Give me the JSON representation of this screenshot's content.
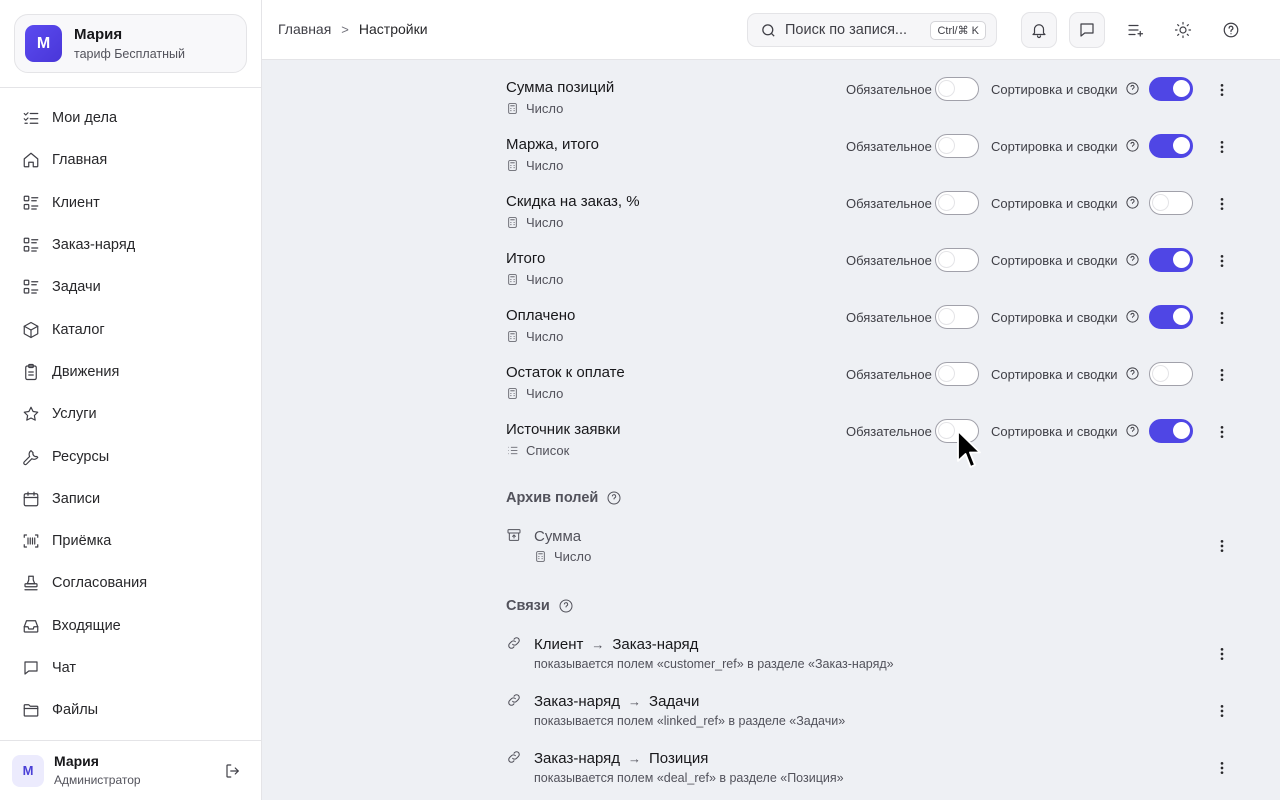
{
  "account": {
    "initial": "М",
    "name": "Мария",
    "plan": "тариф Бесплатный"
  },
  "nav": [
    {
      "label": "Мои дела",
      "icon": "checklist-icon"
    },
    {
      "label": "Главная",
      "icon": "home-icon"
    },
    {
      "label": "Клиент",
      "icon": "list-icon"
    },
    {
      "label": "Заказ-наряд",
      "icon": "list-icon"
    },
    {
      "label": "Задачи",
      "icon": "list-icon"
    },
    {
      "label": "Каталог",
      "icon": "box-icon"
    },
    {
      "label": "Движения",
      "icon": "clipboard-icon"
    },
    {
      "label": "Услуги",
      "icon": "star-icon"
    },
    {
      "label": "Ресурсы",
      "icon": "wrench-icon"
    },
    {
      "label": "Записи",
      "icon": "calendar-icon"
    },
    {
      "label": "Приёмка",
      "icon": "barcode-icon"
    },
    {
      "label": "Согласования",
      "icon": "stamp-icon"
    },
    {
      "label": "Входящие",
      "icon": "inbox-icon"
    },
    {
      "label": "Чат",
      "icon": "chat-icon"
    },
    {
      "label": "Файлы",
      "icon": "folder-icon"
    }
  ],
  "user": {
    "initial": "М",
    "name": "Мария",
    "role": "Администратор"
  },
  "breadcrumb": {
    "home": "Главная",
    "separator": ">",
    "current": "Настройки"
  },
  "search": {
    "placeholder": "Поиск по запися...",
    "shortcut": "Ctrl/⌘ K"
  },
  "fields": [
    {
      "name": "Сумма позиций",
      "type": "Число",
      "type_icon": "calculator-icon",
      "required": false,
      "sortable": true
    },
    {
      "name": "Маржа, итого",
      "type": "Число",
      "type_icon": "calculator-icon",
      "required": false,
      "sortable": true
    },
    {
      "name": "Скидка на заказ, %",
      "type": "Число",
      "type_icon": "calculator-icon",
      "required": false,
      "sortable": false
    },
    {
      "name": "Итого",
      "type": "Число",
      "type_icon": "calculator-icon",
      "required": false,
      "sortable": true
    },
    {
      "name": "Оплачено",
      "type": "Число",
      "type_icon": "calculator-icon",
      "required": false,
      "sortable": true
    },
    {
      "name": "Остаток к оплате",
      "type": "Число",
      "type_icon": "calculator-icon",
      "required": false,
      "sortable": false
    },
    {
      "name": "Источник заявки",
      "type": "Список",
      "type_icon": "list-icon",
      "required": false,
      "sortable": true
    }
  ],
  "labels": {
    "required": "Обязательное",
    "sort": "Сортировка и сводки"
  },
  "archive": {
    "title": "Архив полей",
    "items": [
      {
        "name": "Сумма",
        "type": "Число"
      }
    ]
  },
  "links": {
    "title": "Связи",
    "items": [
      {
        "from": "Клиент",
        "to": "Заказ-наряд",
        "desc": "показывается полем «customer_ref» в разделе «Заказ-наряд»"
      },
      {
        "from": "Заказ-наряд",
        "to": "Задачи",
        "desc": "показывается полем «linked_ref» в разделе «Задачи»"
      },
      {
        "from": "Заказ-наряд",
        "to": "Позиция",
        "desc": "показывается полем «deal_ref» в разделе «Позиция»"
      }
    ]
  },
  "colors": {
    "accent": "#4f46e5",
    "background": "#eef0f4",
    "sidebar": "#ffffff"
  }
}
